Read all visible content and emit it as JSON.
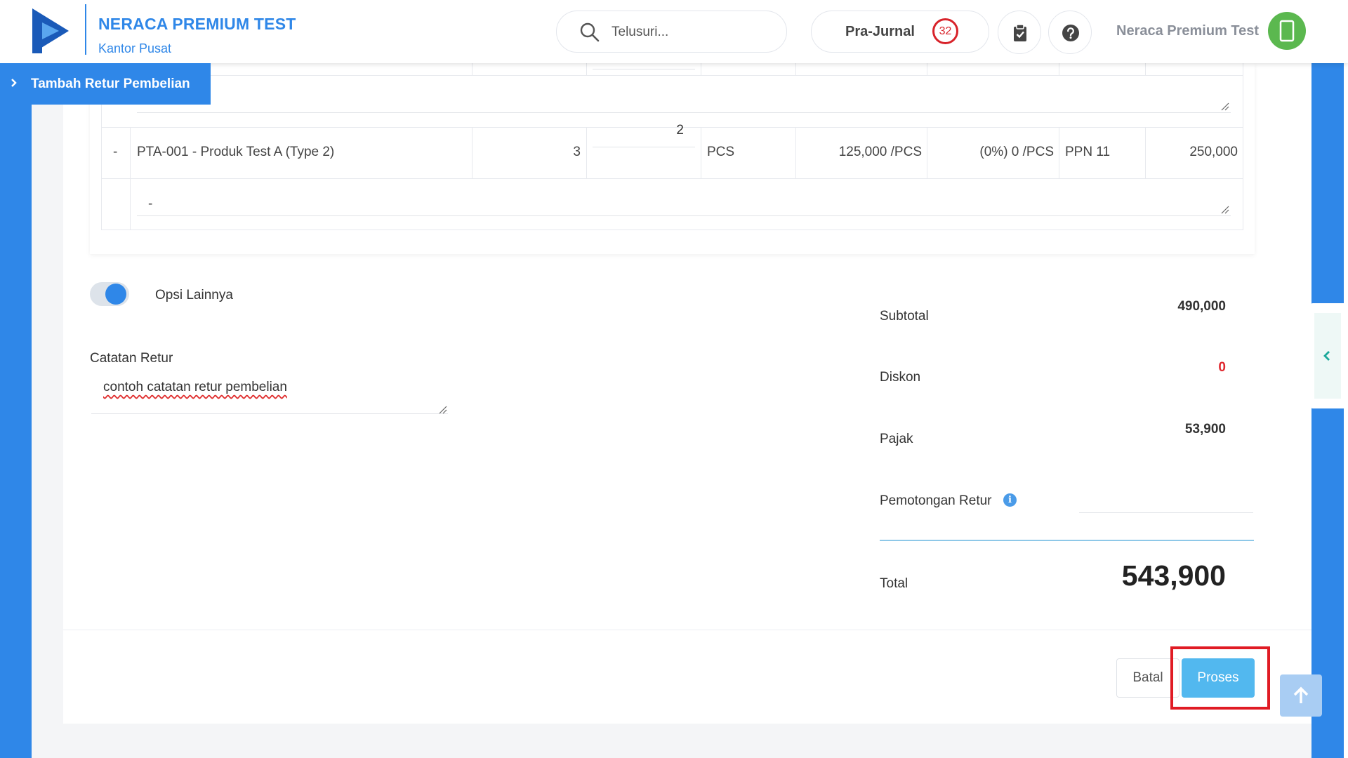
{
  "header": {
    "company_name": "NERACA PREMIUM TEST",
    "branch": "Kantor Pusat",
    "search_placeholder": "Telusuri...",
    "prajurnal_label": "Pra-Jurnal",
    "prajurnal_count": "32",
    "user_name": "Neraca Premium Test",
    "brand_color": "#2f87e8"
  },
  "page_tab": {
    "label": "Tambah Retur Pembelian"
  },
  "table": {
    "rows": [
      {
        "dash": "-",
        "product": "PTA-001 - Produk Test A (Type 2)",
        "qty_available": "3",
        "qty_return": "2",
        "unit": "PCS",
        "price": "125,000 /PCS",
        "discount": "(0%) 0 /PCS",
        "tax": "PPN 11",
        "amount": "250,000",
        "note": "-"
      }
    ]
  },
  "options": {
    "toggle_label": "Opsi Lainnya",
    "notes_label": "Catatan Retur",
    "notes_value": "contoh catatan retur pembelian"
  },
  "summary": {
    "subtotal_label": "Subtotal",
    "subtotal_value": "490,000",
    "discount_label": "Diskon",
    "discount_value": "0",
    "tax_label": "Pajak",
    "tax_value": "53,900",
    "deduction_label": "Pemotongan Retur",
    "total_label": "Total",
    "total_value": "543,900"
  },
  "actions": {
    "cancel_label": "Batal",
    "process_label": "Proses",
    "process_color": "#52b8ef",
    "highlight_color": "#e01b24"
  }
}
